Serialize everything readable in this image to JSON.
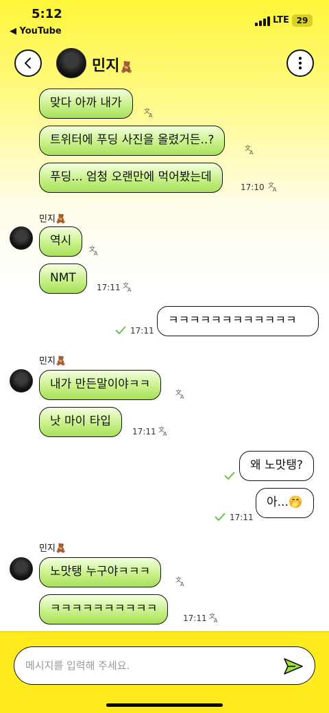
{
  "status": {
    "time": "5:12",
    "back_app": "◀ YouTube",
    "network": "LTE",
    "battery": "29"
  },
  "header": {
    "title": "민지",
    "emoji": "🧸"
  },
  "messages": [
    {
      "text": "맞다 아까 내가"
    },
    {
      "text": "트위터에 푸딩 사진을 올렸거든..?"
    },
    {
      "text": "푸딩... 엄청 오랜만에 먹어봤는데",
      "time": "17:10"
    },
    {
      "sender": "민지",
      "emoji": "🧸"
    },
    {
      "text": "역시"
    },
    {
      "text": "NMT",
      "time": "17:11"
    },
    {
      "text": "ㅋㅋㅋㅋㅋㅋㅋㅋㅋㅋㅋㅋ",
      "time": "17:11"
    },
    {
      "sender": "민지",
      "emoji": "🧸"
    },
    {
      "text": "내가 만든말이야ㅋㅋ"
    },
    {
      "text": "낫 마이 타입",
      "time": "17:11"
    },
    {
      "text": "왜 노맛탱?"
    },
    {
      "text": "아...🤭",
      "time": "17:11"
    },
    {
      "sender": "민지",
      "emoji": "🧸"
    },
    {
      "text": "노맛탱 누구야ㅋㅋㅋ"
    },
    {
      "text": "ㅋㅋㅋㅋㅋㅋㅋㅋㅋㅋ",
      "time": "17:11"
    }
  ],
  "input": {
    "placeholder": "메시지를 입력해 주세요."
  },
  "icons": {
    "back": "chevron-left-icon",
    "more": "more-vertical-icon",
    "translate": "translate-icon",
    "read": "check-icon",
    "send": "send-icon"
  },
  "colors": {
    "header_yellow": "#fff63a",
    "incoming_bubble": "#c9f08a",
    "input_bar": "#ffeb1e",
    "check": "#6cc04a"
  }
}
